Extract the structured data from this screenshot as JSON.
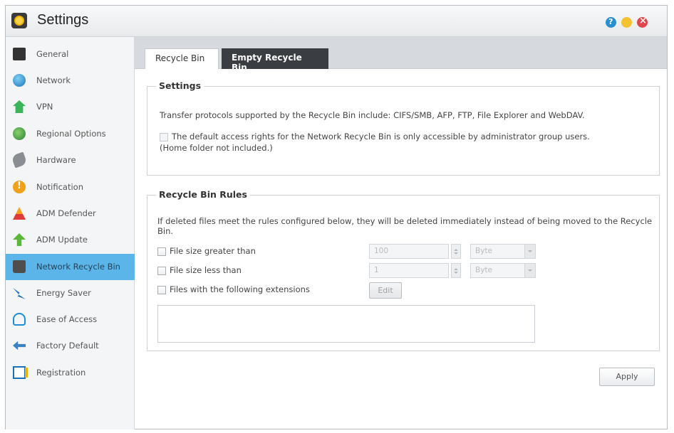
{
  "window": {
    "title": "Settings"
  },
  "sidebar": {
    "items": [
      {
        "label": "General",
        "icon": "general-icon"
      },
      {
        "label": "Network",
        "icon": "globe-icon"
      },
      {
        "label": "VPN",
        "icon": "vpn-icon"
      },
      {
        "label": "Regional Options",
        "icon": "regional-icon"
      },
      {
        "label": "Hardware",
        "icon": "hardware-icon"
      },
      {
        "label": "Notification",
        "icon": "notification-icon"
      },
      {
        "label": "ADM Defender",
        "icon": "defender-icon"
      },
      {
        "label": "ADM Update",
        "icon": "update-arrow-icon"
      },
      {
        "label": "Network Recycle Bin",
        "icon": "trash-icon",
        "active": true
      },
      {
        "label": "Energy Saver",
        "icon": "energy-icon"
      },
      {
        "label": "Ease of Access",
        "icon": "cloud-icon"
      },
      {
        "label": "Factory Default",
        "icon": "back-arrow-icon"
      },
      {
        "label": "Registration",
        "icon": "registration-icon"
      }
    ]
  },
  "tabs": [
    {
      "label": "Recycle Bin",
      "active": true
    },
    {
      "label": "Empty Recycle Bin",
      "active": false
    }
  ],
  "settings_group": {
    "legend": "Settings",
    "protocols_text": "Transfer protocols supported by the Recycle Bin include: CIFS/SMB, AFP, FTP, File Explorer and WebDAV.",
    "admin_only_checkbox_label": "The default access rights for the Network Recycle Bin is only accessible by administrator group users.",
    "admin_only_note": "(Home folder not included.)"
  },
  "rules_group": {
    "legend": "Recycle Bin Rules",
    "description": "If deleted files meet the rules configured below, they will be deleted immediately instead of being moved to the Recycle Bin.",
    "size_greater": {
      "label": "File size greater than",
      "value": "100",
      "unit": "Byte"
    },
    "size_less": {
      "label": "File size less than",
      "value": "1",
      "unit": "Byte"
    },
    "extensions": {
      "label": "Files with the following extensions",
      "edit_label": "Edit"
    }
  },
  "footer": {
    "apply_label": "Apply"
  }
}
